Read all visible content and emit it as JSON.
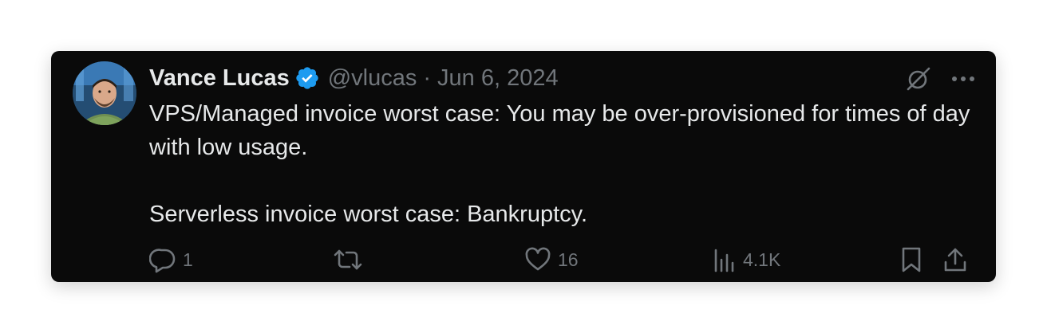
{
  "author": {
    "name": "Vance Lucas",
    "handle": "@vlucas",
    "separator": "·",
    "date": "Jun 6, 2024",
    "verified": true
  },
  "icons": {
    "verified": "verified-badge-icon",
    "grok": "grok-icon",
    "more": "more-icon",
    "reply": "reply-icon",
    "retweet": "retweet-icon",
    "like": "like-icon",
    "views": "views-icon",
    "bookmark": "bookmark-icon",
    "share": "share-icon"
  },
  "colors": {
    "card_background": "#0a0a0a",
    "text_primary": "#e7e9ea",
    "text_secondary": "#71767b",
    "verified_blue": "#1d9bf0"
  },
  "tweet": {
    "paragraphs": [
      "VPS/Managed invoice worst case: You may be over-provisioned for times of day with low usage.",
      "Serverless invoice worst case: Bankruptcy."
    ]
  },
  "metrics": {
    "replies": "1",
    "likes": "16",
    "views": "4.1K"
  }
}
